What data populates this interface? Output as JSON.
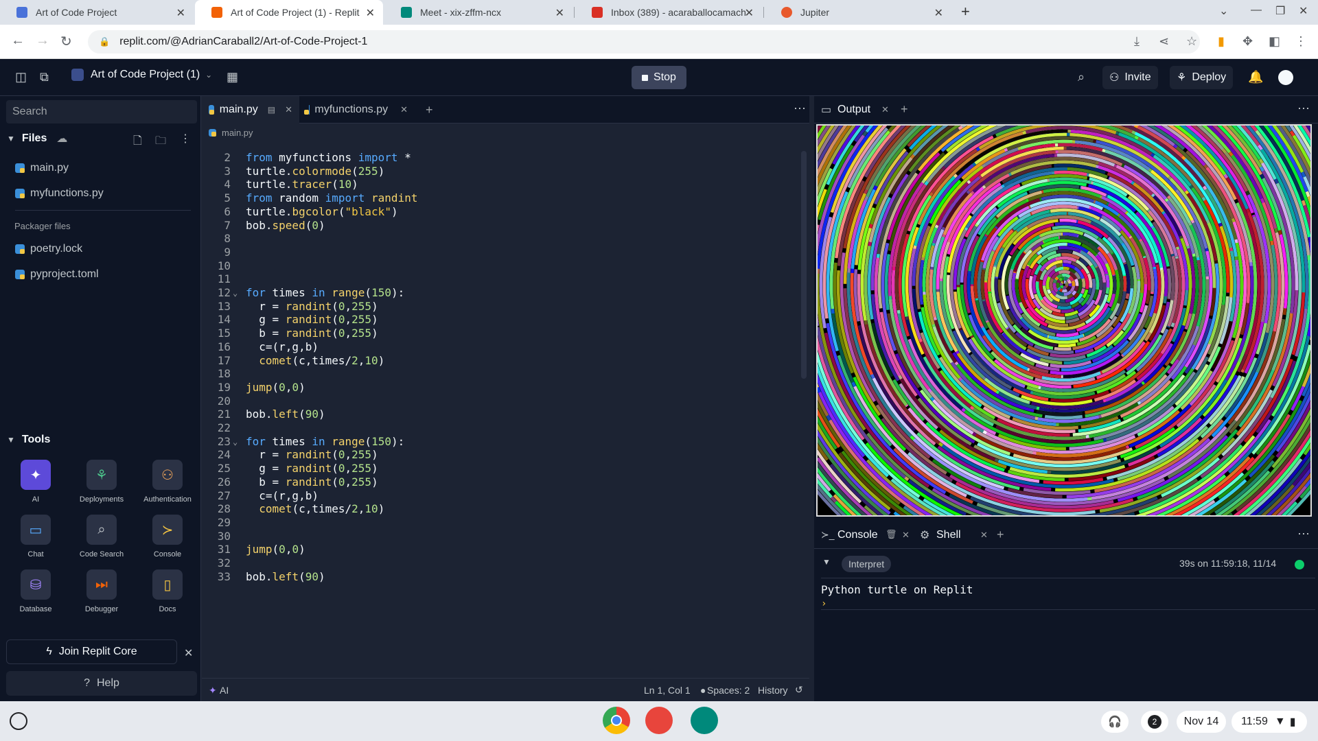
{
  "browser": {
    "tabs": [
      {
        "title": "Art of Code Project",
        "color": "#4a72d9"
      },
      {
        "title": "Art of Code Project (1) - Replit",
        "color": "#f26207"
      },
      {
        "title": "Meet - xix-zffm-ncx",
        "color": "#00897b"
      },
      {
        "title": "Inbox (389) - acaraballocamach",
        "color": "#d93025"
      },
      {
        "title": "Jupiter",
        "color": "#e8592c"
      }
    ],
    "url": "replit.com/@AdrianCaraball2/Art-of-Code-Project-1"
  },
  "header": {
    "project_name": "Art of Code Project (1)",
    "stop_label": "Stop",
    "invite_label": "Invite",
    "deploy_label": "Deploy"
  },
  "sidebar": {
    "search_placeholder": "Search",
    "files_title": "Files",
    "files": [
      "main.py",
      "myfunctions.py"
    ],
    "packager_label": "Packager files",
    "packager_files": [
      "poetry.lock",
      "pyproject.toml"
    ],
    "tools_title": "Tools",
    "tools": [
      "AI",
      "Deployments",
      "Authentication",
      "Chat",
      "Code Search",
      "Console",
      "Database",
      "Debugger",
      "Docs"
    ],
    "join_label": "Join Replit Core",
    "help_label": "Help"
  },
  "editor": {
    "tabs": [
      "main.py",
      "myfunctions.py"
    ],
    "breadcrumb": "main.py",
    "lines": [
      {
        "n": "2",
        "t": "from myfunctions import *"
      },
      {
        "n": "3",
        "t": "turtle.colormode(255)"
      },
      {
        "n": "4",
        "t": "turtle.tracer(10)"
      },
      {
        "n": "5",
        "t": "from random import randint"
      },
      {
        "n": "6",
        "t": "turtle.bgcolor(\"black\")"
      },
      {
        "n": "7",
        "t": "bob.speed(0)"
      },
      {
        "n": "8",
        "t": ""
      },
      {
        "n": "9",
        "t": ""
      },
      {
        "n": "10",
        "t": ""
      },
      {
        "n": "11",
        "t": ""
      },
      {
        "n": "12",
        "t": "for times in range(150):"
      },
      {
        "n": "13",
        "t": "  r = randint(0,255)"
      },
      {
        "n": "14",
        "t": "  g = randint(0,255)"
      },
      {
        "n": "15",
        "t": "  b = randint(0,255)"
      },
      {
        "n": "16",
        "t": "  c=(r,g,b)"
      },
      {
        "n": "17",
        "t": "  comet(c,times/2,10)"
      },
      {
        "n": "18",
        "t": ""
      },
      {
        "n": "19",
        "t": "jump(0,0)"
      },
      {
        "n": "20",
        "t": ""
      },
      {
        "n": "21",
        "t": "bob.left(90)"
      },
      {
        "n": "22",
        "t": ""
      },
      {
        "n": "23",
        "t": "for times in range(150):"
      },
      {
        "n": "24",
        "t": "  r = randint(0,255)"
      },
      {
        "n": "25",
        "t": "  g = randint(0,255)"
      },
      {
        "n": "26",
        "t": "  b = randint(0,255)"
      },
      {
        "n": "27",
        "t": "  c=(r,g,b)"
      },
      {
        "n": "28",
        "t": "  comet(c,times/2,10)"
      },
      {
        "n": "29",
        "t": ""
      },
      {
        "n": "30",
        "t": ""
      },
      {
        "n": "31",
        "t": "jump(0,0)"
      },
      {
        "n": "32",
        "t": ""
      },
      {
        "n": "33",
        "t": "bob.left(90)"
      }
    ],
    "status_ai": "AI",
    "status_pos": "Ln 1, Col 1",
    "status_spaces": "Spaces: 2",
    "status_history": "History"
  },
  "output": {
    "tab_label": "Output"
  },
  "console": {
    "tab_console": "Console",
    "tab_shell": "Shell",
    "pill": "Interpret",
    "run_info": "39s on 11:59:18, 11/14",
    "output_text": "Python turtle on Replit",
    "prompt": "›"
  },
  "taskbar": {
    "badge": "2",
    "date": "Nov 14",
    "time": "11:59"
  },
  "colors": {
    "accent": "#0079f2",
    "bg_dark": "#0e1525",
    "bg_panel": "#1c2333"
  }
}
